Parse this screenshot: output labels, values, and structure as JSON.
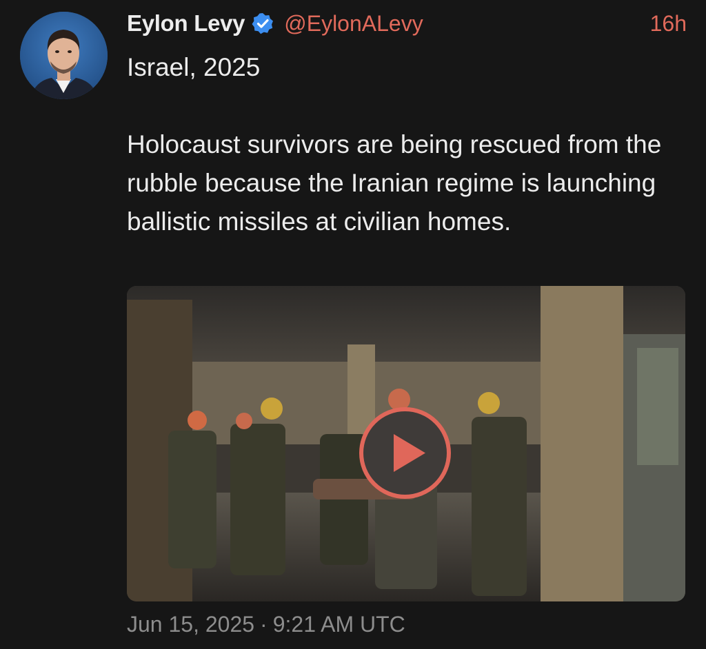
{
  "author": {
    "name": "Eylon Levy",
    "handle": "@EylonALevy",
    "verified_icon": "verified-badge-icon",
    "avatar_icon": "avatar-photo"
  },
  "tweet": {
    "relative_time": "16h",
    "text": "Israel, 2025\n\nHolocaust survivors are being rescued from the rubble because the Iranian regime is launching ballistic missiles at civilian homes.",
    "media": {
      "type": "video",
      "play_icon": "play-icon"
    },
    "date": "Jun 15, 2025",
    "separator": "·",
    "time": "9:21 AM UTC"
  },
  "colors": {
    "background": "#161616",
    "accent": "#e16a5b",
    "verified": "#3c8ef0",
    "muted": "#8d8d8d"
  }
}
